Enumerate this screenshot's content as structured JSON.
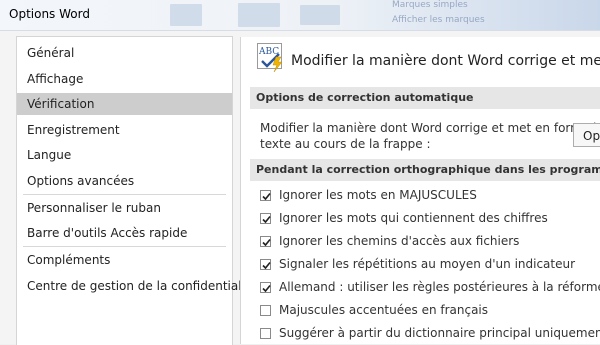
{
  "window": {
    "title": "Options Word",
    "background_hints": [
      "Marques simples",
      "Afficher les marques"
    ]
  },
  "nav": {
    "items": [
      {
        "label": "Général",
        "selected": false
      },
      {
        "label": "Affichage",
        "selected": false
      },
      {
        "label": "Vérification",
        "selected": true
      },
      {
        "label": "Enregistrement",
        "selected": false
      },
      {
        "label": "Langue",
        "selected": false
      },
      {
        "label": "Options avancées",
        "selected": false
      },
      {
        "label": "Personnaliser le ruban",
        "selected": false
      },
      {
        "label": "Barre d'outils Accès rapide",
        "selected": false
      },
      {
        "label": "Compléments",
        "selected": false
      },
      {
        "label": "Centre de gestion de la confidentialité",
        "selected": false
      }
    ]
  },
  "content": {
    "header_icon": "abc-checkmark-icon",
    "header_title": "Modifier la manière dont Word corrige et met en for",
    "autocorrect_section": {
      "title": "Options de correction automatique",
      "description_lines": [
        "Modifier la manière dont Word corrige et met en forme le",
        "texte au cours de la frappe :"
      ],
      "button_label": "Opt"
    },
    "spelling_section": {
      "title": "Pendant la correction orthographique dans les programmes Mic",
      "options": [
        {
          "label": "Ignorer les mots en MAJUSCULES",
          "checked": true
        },
        {
          "label": "Ignorer les mots qui contiennent des chiffres",
          "checked": true
        },
        {
          "label": "Ignorer les chemins d'accès aux fichiers",
          "checked": true
        },
        {
          "label": "Signaler les répétitions au moyen d'un indicateur",
          "checked": true
        },
        {
          "label": "Allemand : utiliser les règles postérieures à la réforme de l'ortho",
          "checked": true
        },
        {
          "label": "Majuscules accentuées en français",
          "checked": false
        },
        {
          "label": "Suggérer à partir du dictionnaire principal uniquement",
          "checked": false
        }
      ]
    }
  },
  "colors": {
    "selected_nav_bg": "#cdcdcd",
    "section_bg": "#e6e6e6",
    "icon_blue": "#2b579a",
    "icon_yellow": "#f0b400"
  }
}
